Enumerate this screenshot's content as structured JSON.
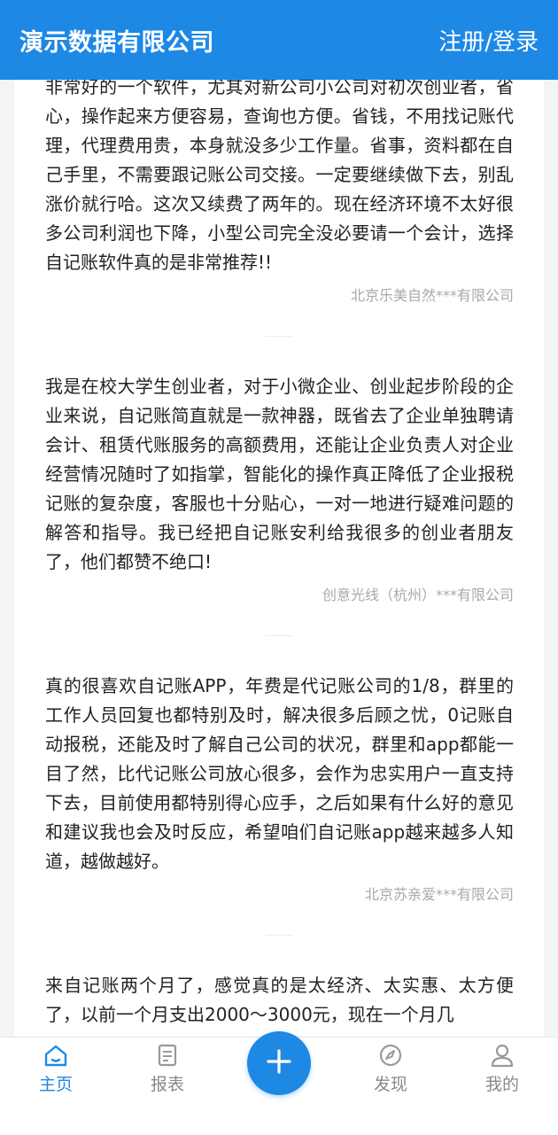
{
  "header": {
    "title": "演示数据有限公司",
    "auth_label": "注册/登录"
  },
  "reviews": [
    {
      "text": "非常好的一个软件，尤其对新公司小公司对初次创业者，省心，操作起来方便容易，查询也方便。省钱，不用找记账代理，代理费用贵，本身就没多少工作量。省事，资料都在自己手里，不需要跟记账公司交接。一定要继续做下去，别乱涨价就行哈。这次又续费了两年的。现在经济环境不太好很多公司利润也下降，小型公司完全没必要请一个会计，选择自记账软件真的是非常推荐!!",
      "company": "北京乐美自然***有限公司"
    },
    {
      "text": "我是在校大学生创业者，对于小微企业、创业起步阶段的企业来说，自记账简直就是一款神器，既省去了企业单独聘请会计、租赁代账服务的高额费用，还能让企业负责人对企业经营情况随时了如指掌，智能化的操作真正降低了企业报税记账的复杂度，客服也十分贴心，一对一地进行疑难问题的解答和指导。我已经把自记账安利给我很多的创业者朋友了，他们都赞不绝口!",
      "company": "创意光线（杭州）***有限公司"
    },
    {
      "text": "真的很喜欢自记账APP，年费是代记账公司的1/8，群里的工作人员回复也都特别及时，解决很多后顾之忧，0记账自动报税，还能及时了解自己公司的状况，群里和app都能一目了然，比代记账公司放心很多，会作为忠实用户一直支持下去，目前使用都特别得心应手，之后如果有什么好的意见和建议我也会及时反应，希望咱们自记账app越来越多人知道，越做越好。",
      "company": "北京苏亲爱***有限公司"
    },
    {
      "text": "来自记账两个月了，感觉真的是太经济、太实惠、太方便了，以前一个月支出2000～3000元，现在一个月几",
      "company": ""
    }
  ],
  "nav": {
    "home": "主页",
    "report": "报表",
    "discover": "发现",
    "mine": "我的"
  },
  "colors": {
    "brand": "#1e88e5",
    "inactive": "#888888"
  },
  "icons": {
    "home": "home-icon",
    "report": "report-icon",
    "add": "plus-icon",
    "discover": "compass-icon",
    "mine": "user-icon"
  }
}
